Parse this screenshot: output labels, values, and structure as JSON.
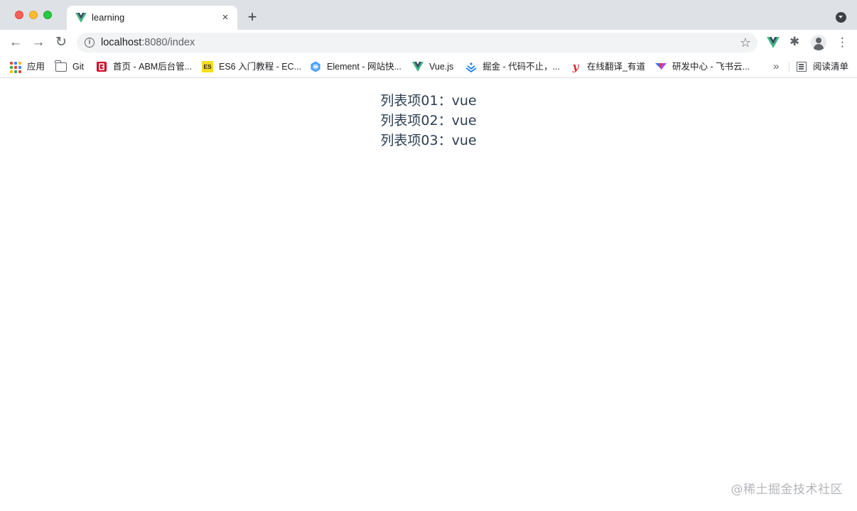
{
  "window": {
    "tab": {
      "title": "learning",
      "close": "×"
    },
    "new_tab": "+"
  },
  "toolbar": {
    "back": "←",
    "forward": "→",
    "reload": "↻",
    "url_host": "localhost",
    "url_path": ":8080/index",
    "star": "☆",
    "menu": "⋮",
    "info": "i",
    "puzzle": "✱"
  },
  "bookmarks": {
    "items": [
      {
        "label": "应用",
        "icon": "apps-grid-icon"
      },
      {
        "label": "Git",
        "icon": "folder-icon"
      },
      {
        "label": "首页 - ABM后台管...",
        "icon": "abm-icon"
      },
      {
        "label": "ES6 入门教程 - EC...",
        "icon": "es6-icon",
        "badge": "ES"
      },
      {
        "label": "Element - 网站快...",
        "icon": "element-icon"
      },
      {
        "label": "Vue.js",
        "icon": "vue-icon"
      },
      {
        "label": "掘金 - 代码不止，...",
        "icon": "juejin-icon"
      },
      {
        "label": "在线翻译_有道",
        "icon": "youdao-icon",
        "badge": "y"
      },
      {
        "label": "研发中心 - 飞书云...",
        "icon": "feishu-icon"
      }
    ],
    "more": "»",
    "reading_list": "阅读清单"
  },
  "content": {
    "items": [
      {
        "label": "列表项01：",
        "value": "vue"
      },
      {
        "label": "列表项02：",
        "value": "vue"
      },
      {
        "label": "列表项03：",
        "value": "vue"
      }
    ]
  },
  "watermark": "@稀土掘金技术社区",
  "colors": {
    "tabstrip": "#dee1e6",
    "vue_green": "#41b883",
    "vue_dark": "#34495e",
    "text": "#2c3e50"
  }
}
